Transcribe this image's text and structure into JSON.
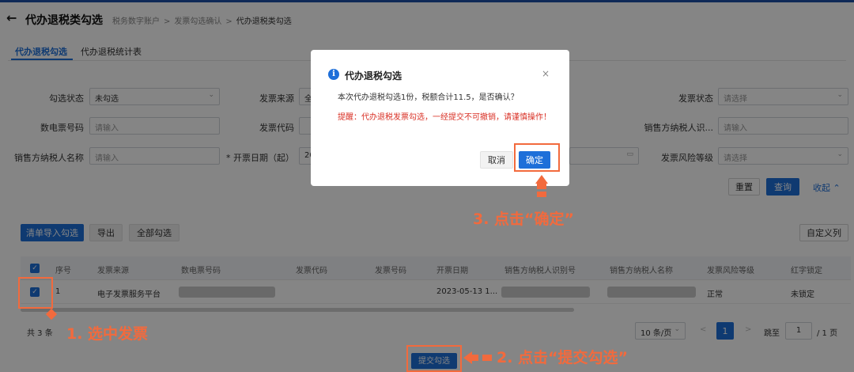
{
  "header": {
    "back_icon": "arrow-left-icon",
    "title": "代办退税类勾选",
    "breadcrumbs": [
      "税务数字账户",
      "发票勾选确认",
      "代办退税类勾选"
    ]
  },
  "tabs": [
    {
      "label": "代办退税勾选",
      "active": true
    },
    {
      "label": "代办退税统计表",
      "active": false
    }
  ],
  "filters": {
    "check_status": {
      "label": "勾选状态",
      "value": "未勾选"
    },
    "invoice_source": {
      "label": "发票来源",
      "value": "全"
    },
    "invoice_status": {
      "label": "发票状态",
      "placeholder": "请选择"
    },
    "e_invoice_no": {
      "label": "数电票号码",
      "placeholder": "请输入"
    },
    "invoice_code": {
      "label": "发票代码"
    },
    "seller_tax_id": {
      "label": "销售方纳税人识...",
      "placeholder": "请输入"
    },
    "seller_name": {
      "label": "销售方纳税人名称",
      "placeholder": "请输入"
    },
    "issue_date_start": {
      "label": "* 开票日期（起）",
      "value": "20"
    },
    "risk_level": {
      "label": "发票风险等级",
      "placeholder": "请选择"
    }
  },
  "actions": {
    "reset": "重置",
    "query": "查询",
    "collapse": "收起"
  },
  "toolbar": {
    "import_check": "清单导入勾选",
    "export": "导出",
    "check_all": "全部勾选",
    "custom_columns": "自定义列"
  },
  "table": {
    "columns": [
      "序号",
      "发票来源",
      "数电票号码",
      "发票代码",
      "发票号码",
      "开票日期",
      "销售方纳税人识别号",
      "销售方纳税人名称",
      "发票风险等级",
      "红字锁定"
    ],
    "rows": [
      {
        "index": "1",
        "source": "电子发票服务平台",
        "e_invoice_no": "",
        "code": "",
        "number": "",
        "date": "2023-05-13 1...",
        "seller_id": "",
        "seller_name": "",
        "risk": "正常",
        "red_lock": "未锁定"
      }
    ]
  },
  "pagination": {
    "total": "共 3 条",
    "page_size": "10 条/页",
    "prev": "<",
    "current_page": "1",
    "next": ">",
    "goto_label": "跳至",
    "goto_value": "1",
    "total_pages": "/ 1 页"
  },
  "submit_button": "提交勾选",
  "dialog": {
    "info_icon": "info-icon",
    "title": "代办退税勾选",
    "close": "×",
    "message": "本次代办退税勾选1份，税额合计11.5，是否确认？",
    "warning": "提醒：代办退税发票勾选，一经提交不可撤销，请谨慎操作！",
    "cancel": "取消",
    "confirm": "确定"
  },
  "annotations": {
    "step1": "1. 选中发票",
    "step2": "2. 点击“提交勾选”",
    "step3": "3. 点击“确定”",
    "color": "#f26a3d"
  }
}
